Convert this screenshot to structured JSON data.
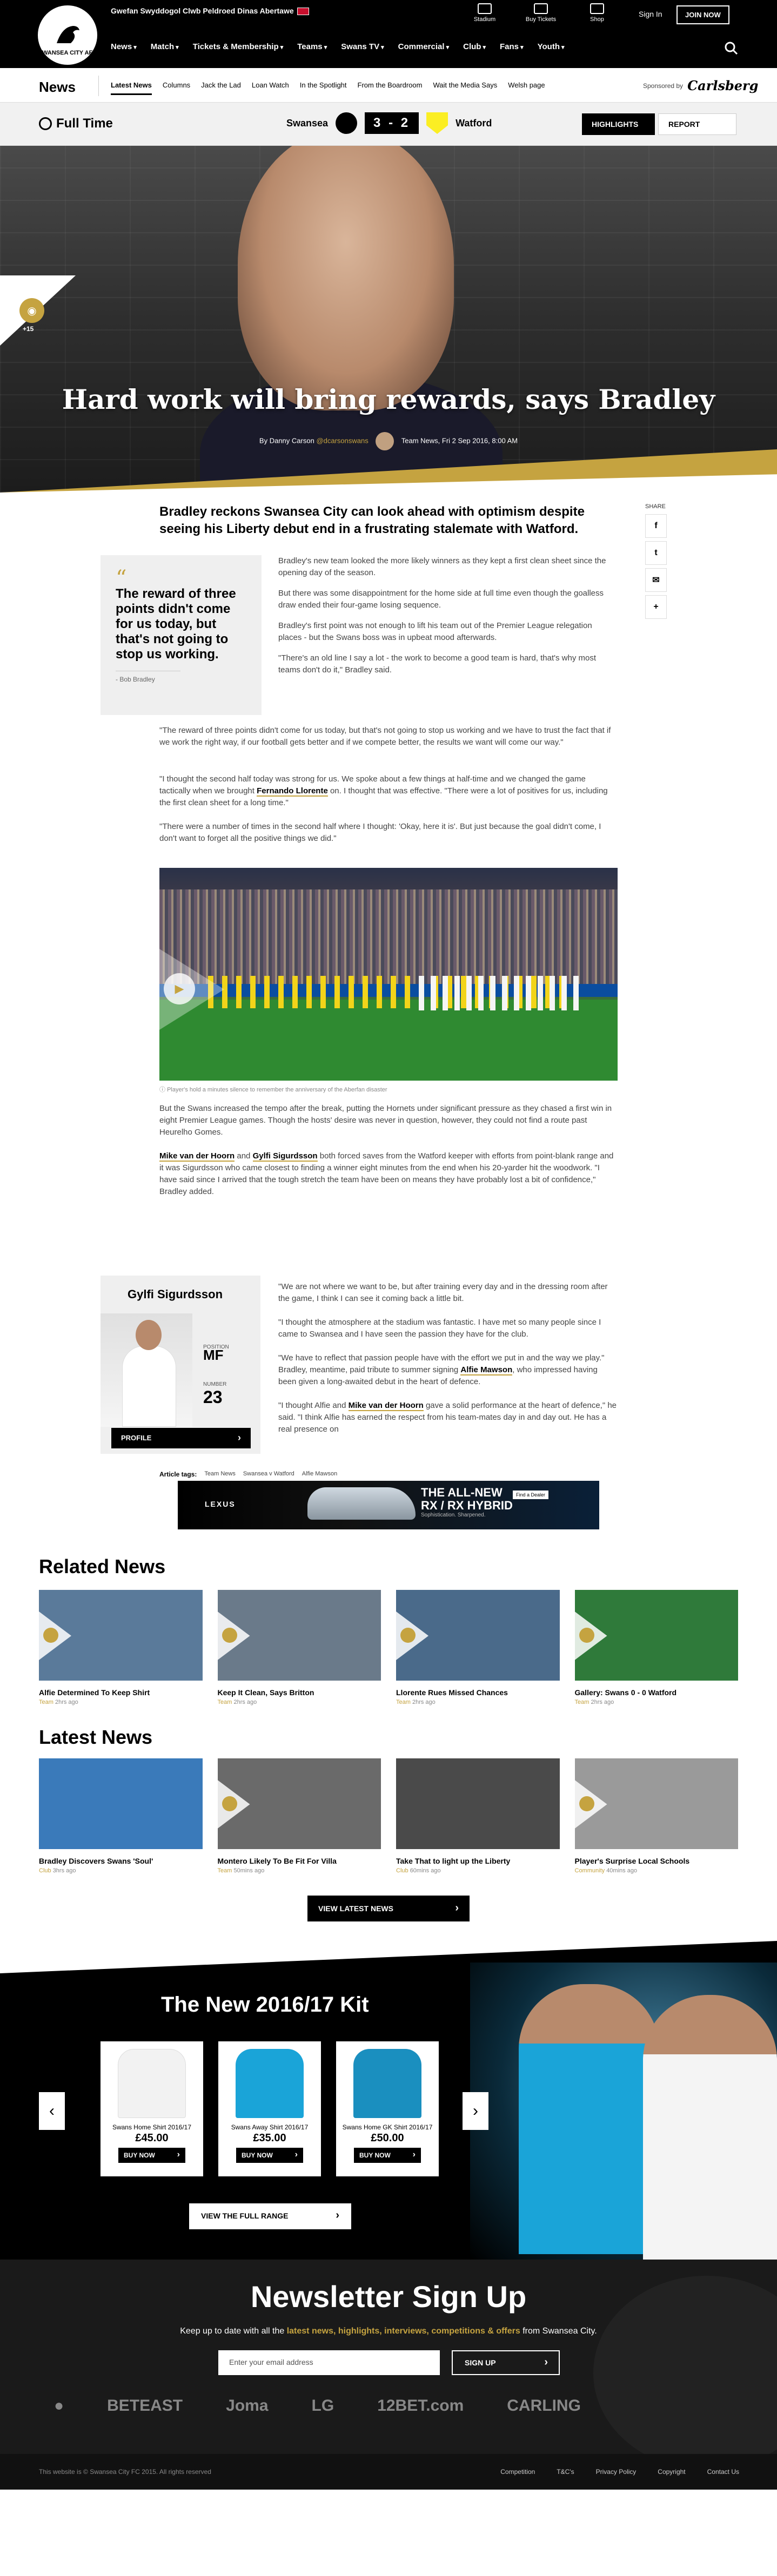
{
  "header": {
    "crest_text": "SWANSEA CITY AFC",
    "welsh": "Gwefan Swyddogol Clwb Peldroed Dinas Abertawe",
    "icons": [
      {
        "label": "Stadium",
        "icon": "stadium-icon"
      },
      {
        "label": "Buy Tickets",
        "icon": "ticket-icon"
      },
      {
        "label": "Shop",
        "icon": "shop-icon"
      }
    ],
    "signin": "Sign In",
    "joinnow": "JOIN NOW",
    "nav": [
      "News",
      "Match",
      "Tickets & Membership",
      "Teams",
      "Swans TV",
      "Commercial",
      "Club",
      "Fans",
      "Youth"
    ]
  },
  "subnav": {
    "title": "News",
    "items": [
      "Latest News",
      "Columns",
      "Jack the Lad",
      "Loan Watch",
      "In the Spotlight",
      "From the Boardroom",
      "Wait the Media Says",
      "Welsh page"
    ],
    "sponsored": "Sponsored by",
    "sponsor": "Carlsberg"
  },
  "match": {
    "status": "Full Time",
    "home": "Swansea",
    "score": "3 - 2",
    "away": "Watford",
    "highlights": "HIGHLIGHTS",
    "report": "REPORT"
  },
  "hero": {
    "gallery_count": "+15",
    "title": "Hard work will bring rewards, says Bradley",
    "author": "By Danny Carson",
    "handle": "@dcarsonswans",
    "meta": "Team News, Fri 2 Sep 2016, 8:00 AM"
  },
  "article": {
    "lede": "Bradley reckons Swansea City can look ahead with optimism despite seeing his Liberty debut end in a frustrating stalemate with Watford.",
    "share_label": "SHARE",
    "quote": "The reward of three points didn't come for us today, but that's not going to stop us working.",
    "quote_author": "- Bob Bradley",
    "p1": "Bradley's new team looked the more likely winners as they kept a first clean sheet since the opening day of the season.",
    "p2": "But there was some disappointment for the home side at full time even though the goalless draw ended their four-game losing sequence.",
    "p3": "Bradley's first point was not enough to lift his team out of the Premier League relegation places - but the Swans boss was in upbeat mood afterwards.",
    "p4": "\"There's an old line I say a lot - the work to become a good team is hard, that's why most teams don't do it,\" Bradley said.",
    "p5": "\"The reward of three points didn't come for us today, but that's not going to stop us working and we have to trust the fact that if we work the right way, if our football gets better and if we compete better, the results we want will come our way.\"",
    "p6a": "\"I thought the second half today was strong for us. We spoke about a few things at half-time and we changed the game tactically when we brought ",
    "p6link": "Fernando Llorente",
    "p6b": " on. I thought that was effective. \"There were a lot of positives for us, including the first clean sheet for a long time.\"",
    "p7": "\"There were a number of times in the second half where I thought: 'Okay, here it is'. But just because the goal didn't come, I don't want to forget all the positive things we did.\"",
    "caption": "Player's hold a minutes silence to remember the anniversary of the Aberfan disaster",
    "p8": "But the Swans increased the tempo after the break, putting the Hornets under significant pressure as they chased a first win in eight Premier League games. Though the hosts' desire was never in question, however, they could not find a route past Heurelho Gomes.",
    "p9link1": "Mike van der Hoorn",
    "p9and": " and ",
    "p9link2": "Gylfi Sigurdsson",
    "p9": " both forced saves from the Watford keeper with efforts from point-blank range and it was Sigurdsson who came closest to finding a winner eight minutes from the end when his 20-yarder hit the woodwork. \"I have said since I arrived that the tough stretch the team have been on means they have probably lost a bit of confidence,\" Bradley added.",
    "p10": "\"We are not where we want to be, but after training every day and in the dressing room after the game, I think I can see it coming back a little bit.",
    "p11": "\"I thought the atmosphere at the stadium was fantastic. I have met so many people since I came to Swansea and I have seen the passion they have for the club.",
    "p12a": "\"We have to reflect that passion people have with the effort we put in and the way we play.\"",
    "p12b": "Bradley, meantime, paid tribute to summer signing ",
    "p12link": "Alfie Mawson",
    "p12c": ", who impressed having been given a long-awaited debut in the heart of defence.",
    "p13a": "\"I thought Alfie and ",
    "p13link": "Mike van der Hoorn",
    "p13b": " gave a solid performance at the heart of defence,\" he said. \"I think Alfie has earned the respect from his team-mates day in and day out. He has a real presence on",
    "tags_label": "Article tags:",
    "tags": [
      "Team News",
      "Swansea v Watford",
      "Alfie Mawson"
    ]
  },
  "player": {
    "name": "Gylfi Sigurdsson",
    "pos_label": "POSITION",
    "pos": "MF",
    "num_label": "NUMBER",
    "num": "23",
    "profile": "PROFILE"
  },
  "ad": {
    "brand": "LEXUS",
    "t1": "THE ALL-NEW",
    "t2": "RX / RX HYBRID",
    "t3": "Sophistication. Sharpened.",
    "cta": "Find a Dealer"
  },
  "related": {
    "title": "Related News",
    "items": [
      {
        "title": "Alfie Determined To Keep Shirt",
        "cat": "Team",
        "time": "2hrs ago",
        "bg": "#5a7a9a"
      },
      {
        "title": "Keep It Clean, Says Britton",
        "cat": "Team",
        "time": "2hrs ago",
        "bg": "#6a7a8a"
      },
      {
        "title": "Llorente Rues Missed Chances",
        "cat": "Team",
        "time": "2hrs ago",
        "bg": "#4a6a8a"
      },
      {
        "title": "Gallery: Swans 0 - 0 Watford",
        "cat": "Team",
        "time": "2hrs ago",
        "bg": "#2f7a3a"
      }
    ]
  },
  "latest": {
    "title": "Latest News",
    "items": [
      {
        "title": "Bradley Discovers Swans 'Soul'",
        "cat": "Club",
        "time": "3hrs ago",
        "bg": "#3a7aba"
      },
      {
        "title": "Montero Likely To Be Fit For Villa",
        "cat": "Team",
        "time": "50mins ago",
        "bg": "#6a6a6a"
      },
      {
        "title": "Take That to light up the Liberty",
        "cat": "Club",
        "time": "60mins ago",
        "bg": "#4a4a4a"
      },
      {
        "title": "Player's Surprise Local Schools",
        "cat": "Community",
        "time": "40mins ago",
        "bg": "#9a9a9a"
      }
    ],
    "button": "VIEW LATEST NEWS"
  },
  "kit": {
    "title": "The New 2016/17 Kit",
    "shirts": [
      {
        "name": "Swans Home Shirt 2016/17",
        "price": "£45.00",
        "color": "#f2f2f2"
      },
      {
        "name": "Swans Away Shirt 2016/17",
        "price": "£35.00",
        "color": "#1aa4d8"
      },
      {
        "name": "Swans Home GK Shirt 2016/17",
        "price": "£50.00",
        "color": "#1a8fbf"
      }
    ],
    "buy": "BUY NOW",
    "full": "VIEW THE FULL RANGE"
  },
  "newsletter": {
    "title": "Newsletter Sign Up",
    "text_a": "Keep up to date with all the ",
    "text_b": "latest news, highlights, interviews, competitions & offers",
    "text_c": " from Swansea City.",
    "placeholder": "Enter your email address",
    "button": "SIGN UP",
    "sponsors": [
      "BETEAST",
      "Joma",
      "LG",
      "12BET.com",
      "CARLING"
    ]
  },
  "footer": {
    "copy": "This website is © Swansea City FC 2015. All rights reserved",
    "links": [
      "Competition",
      "T&C's",
      "Privacy Policy",
      "Copyright",
      "Contact Us"
    ]
  }
}
